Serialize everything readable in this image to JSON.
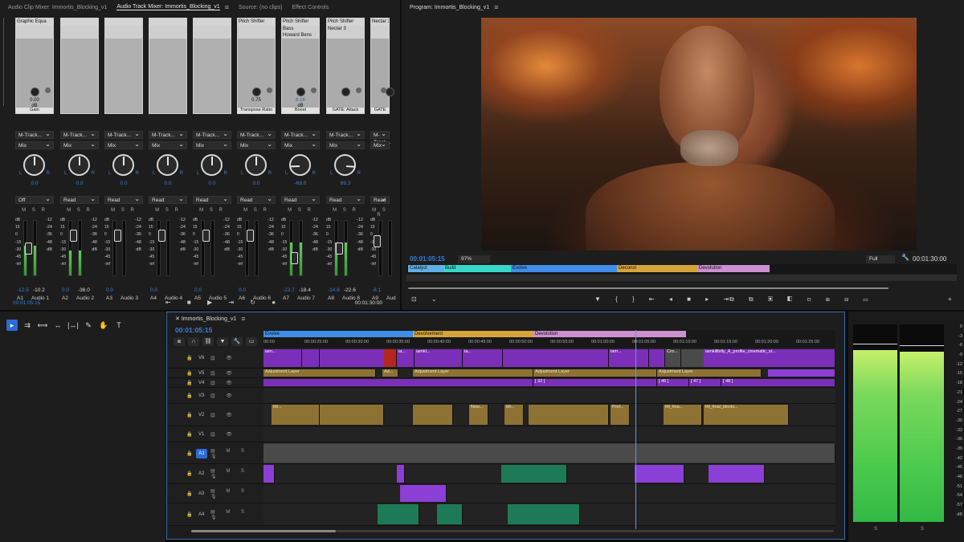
{
  "mixer": {
    "tabs": [
      "Audio Clip Mixer: Immortis_Blocking_v1",
      "Audio Track Mixer: Immortis_Blocking_v1",
      "Source: (no clips)",
      "Effect Controls"
    ],
    "active_tab": 1,
    "strips": [
      {
        "fx": "Graphic Equa",
        "fx2": "",
        "fx3": "",
        "knob_val": "0.00",
        "knob_unit": "dB",
        "knob_bottom": "Gain",
        "track_mode": "M-Track...",
        "send": "Mix",
        "pan": "0.0",
        "automation": "Off",
        "bottom_a": "-12.5",
        "bottom_b": "-10.2",
        "id": "A1",
        "name": "Audio 1"
      },
      {
        "fx": "",
        "fx2": "",
        "fx3": "",
        "knob_val": "",
        "knob_unit": "",
        "knob_bottom": "",
        "track_mode": "M-Track...",
        "send": "Mix",
        "pan": "0.0",
        "automation": "Read",
        "bottom_a": "0.0",
        "bottom_b": "-36.0",
        "id": "A2",
        "name": "Audio 2"
      },
      {
        "fx": "",
        "fx2": "",
        "fx3": "",
        "knob_val": "",
        "knob_unit": "",
        "knob_bottom": "",
        "track_mode": "M-Track...",
        "send": "Mix",
        "pan": "0.0",
        "automation": "Read",
        "bottom_a": "0.0",
        "bottom_b": "",
        "id": "A3",
        "name": "Audio 3"
      },
      {
        "fx": "",
        "fx2": "",
        "fx3": "",
        "knob_val": "",
        "knob_unit": "",
        "knob_bottom": "",
        "track_mode": "M-Track...",
        "send": "Mix",
        "pan": "0.0",
        "automation": "Read",
        "bottom_a": "0.0",
        "bottom_b": "",
        "id": "A4",
        "name": "Audio 4"
      },
      {
        "fx": "",
        "fx2": "",
        "fx3": "",
        "knob_val": "",
        "knob_unit": "",
        "knob_bottom": "",
        "track_mode": "M-Track...",
        "send": "Mix",
        "pan": "0.0",
        "automation": "Read",
        "bottom_a": "0.0",
        "bottom_b": "",
        "id": "A5",
        "name": "Audio 5"
      },
      {
        "fx": "Pitch Shifter",
        "fx2": "",
        "fx3": "",
        "knob_val": "0.75",
        "knob_unit": "",
        "knob_bottom": "Transpose Ratio",
        "track_mode": "M-Track...",
        "send": "Mix",
        "pan": "0.0",
        "automation": "Read",
        "bottom_a": "0.0",
        "bottom_b": "",
        "id": "A6",
        "name": "Audio 6"
      },
      {
        "fx": "Pitch Shifter",
        "fx2": "Bass",
        "fx3": "Howard Bens",
        "knob_val": "8.16",
        "knob_unit": "dB",
        "knob_bottom": "Boost",
        "track_mode": "M-Track...",
        "send": "Mix",
        "pan": "-68.0",
        "automation": "Read",
        "bottom_a": "-23.7",
        "bottom_b": "-18.4",
        "id": "A7",
        "name": "Audio 7"
      },
      {
        "fx": "Pitch Shifter",
        "fx2": "Nectar 3",
        "fx3": "",
        "knob_val": "",
        "knob_unit": "",
        "knob_bottom": "GATE: Attack",
        "track_mode": "M-Track...",
        "send": "Mix",
        "pan": "69.3",
        "automation": "Read",
        "bottom_a": "-14.6",
        "bottom_b": "-22.6",
        "id": "A8",
        "name": "Audio 8"
      },
      {
        "fx": "Nectar 3",
        "fx2": "",
        "fx3": "",
        "knob_val": "",
        "knob_unit": "",
        "knob_bottom": "GATE",
        "track_mode": "M-Track...",
        "send": "Mix",
        "pan": "",
        "automation": "Read",
        "bottom_a": "-6.1",
        "bottom_b": "",
        "id": "A9",
        "name": "Aud"
      }
    ],
    "meter_levels": [
      0.55,
      0.45,
      0,
      0,
      0,
      0,
      0.6,
      0.6,
      0
    ],
    "fader_levels": [
      0.55,
      0.8,
      0.8,
      0.8,
      0.8,
      0.8,
      0.35,
      0.55,
      0.7
    ],
    "timecode": "00:01:05:15",
    "duration": "00:01:30:00",
    "scale_labels": [
      "dB",
      "15",
      "0",
      "-15",
      "-30",
      "-45",
      "-inf"
    ],
    "scale2_labels": [
      "-12",
      "-24",
      "-36",
      "-48",
      "dB"
    ],
    "msr": "M S R"
  },
  "program": {
    "title": "Program: Immortis_Blocking_v1",
    "timecode": "00:01:05:15",
    "zoom": "97%",
    "quality": "Full",
    "duration": "00:01:30:00",
    "markers": [
      "Catalyst",
      "Build",
      "Evolve",
      "Deconst",
      "Devolution"
    ],
    "controls_left": "▼  {  }  ⇤  ◂  ■  ▸  ⇥",
    "controls_right": "⧉ ⧉ ▣ ◧ ⊡ ⊞ ⊟ ▭",
    "add": "+"
  },
  "timeline": {
    "title": "Immortis_Blocking_v1",
    "timecode": "00:01:05:15",
    "markers": [
      "Evolve",
      "Devolvement",
      "Devolution"
    ],
    "ticks": [
      "00:00",
      "00:00:25:00",
      "00:00:30:00",
      "00:00:35:00",
      "00:00:40:00",
      "00:00:45:00",
      "00:00:50:00",
      "00:00:55:00",
      "00:01:00:00",
      "00:01:05:00",
      "00:01:10:00",
      "00:01:15:00",
      "00:01:20:00",
      "00:01:25:00"
    ],
    "tracks": [
      {
        "id": "V6",
        "type": "video"
      },
      {
        "id": "V5",
        "type": "video"
      },
      {
        "id": "V4",
        "type": "video"
      },
      {
        "id": "V3",
        "type": "video"
      },
      {
        "id": "V2",
        "type": "video"
      },
      {
        "id": "V1",
        "type": "video"
      },
      {
        "id": "A1",
        "type": "audio"
      },
      {
        "id": "A2",
        "type": "audio"
      },
      {
        "id": "A3",
        "type": "audio"
      },
      {
        "id": "A4",
        "type": "audio"
      }
    ],
    "clip_labels": {
      "v6_a": "iam...",
      "v6_b": "ia...",
      "v6_c": "iamkl...",
      "v6_d": "ia...",
      "v6_e": "iam...",
      "v6_f": "Cro...",
      "v6_g": "iamkillbilly_A_profile_cinematic_st...",
      "v5_adj1": "Adjustment Layer",
      "v5_adj2": "Ad...",
      "v5_adj3": "Adjustment Layer",
      "v5_adj4": "Adjustment Layer",
      "v5_adj5": "Adjustment Layer",
      "v4_a": "[ 32 ]",
      "v4_b": "[ 46 ]",
      "v4_c": "[ 47 ]",
      "v4_d": "[ 48 ]",
      "v2_a": "iM...",
      "v2_b": "New...",
      "v2_c": "iM...",
      "v2_d": "Prof...",
      "v2_e": "iM_fina...",
      "v2_f": "iM_final_blocki..."
    }
  },
  "meters": {
    "left_level": 0.87,
    "right_level": 0.86,
    "scale": [
      "0",
      "-3",
      "-6",
      "-9",
      "-12",
      "-15",
      "-18",
      "-21",
      "-24",
      "-27",
      "-30",
      "-33",
      "-36",
      "-39",
      "-42",
      "-45",
      "-48",
      "-51",
      "-54",
      "-57",
      "dB"
    ],
    "solo_left": "S",
    "solo_right": "S"
  },
  "tools": {
    "labels": [
      "▸",
      "⇉",
      "⟺",
      "↔",
      "|↔|",
      "✎",
      "✋",
      "T"
    ]
  },
  "colors": {
    "accent": "#2b6bd6",
    "timecode": "#3a7fd5",
    "clip_purple": "#7b2fb8",
    "clip_gold": "#8e7233",
    "clip_green": "#1e7a56"
  }
}
